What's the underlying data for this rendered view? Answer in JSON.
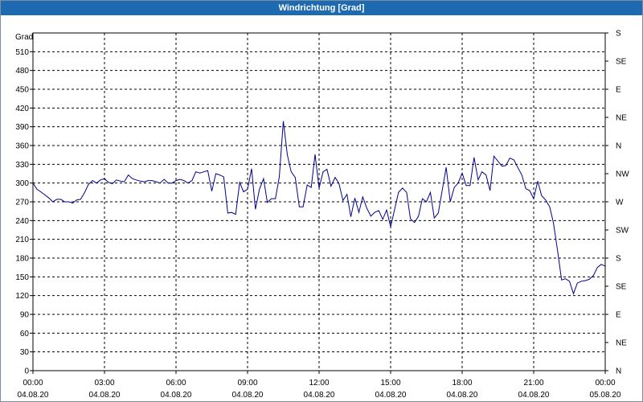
{
  "window": {
    "title": "Windrichtung [Grad]"
  },
  "colors": {
    "titlebar": "#1e6ab0",
    "series": "#00008b",
    "grid": "#000000",
    "background": "#ffffff"
  },
  "chart_data": {
    "type": "line",
    "title": "Windrichtung [Grad]",
    "ylabel": "Grad",
    "xlabel": "",
    "ylim": [
      0,
      540
    ],
    "y_ticks": [
      0,
      30,
      60,
      90,
      120,
      150,
      180,
      210,
      240,
      270,
      300,
      330,
      360,
      390,
      420,
      450,
      480,
      510
    ],
    "y_right_ticks": [
      {
        "value": 0,
        "label": "N"
      },
      {
        "value": 45,
        "label": "NE"
      },
      {
        "value": 90,
        "label": "E"
      },
      {
        "value": 135,
        "label": "SE"
      },
      {
        "value": 180,
        "label": "S"
      },
      {
        "value": 225,
        "label": "SW"
      },
      {
        "value": 270,
        "label": "W"
      },
      {
        "value": 315,
        "label": "NW"
      },
      {
        "value": 360,
        "label": "N"
      },
      {
        "value": 405,
        "label": "NE"
      },
      {
        "value": 450,
        "label": "E"
      },
      {
        "value": 495,
        "label": "SE"
      },
      {
        "value": 540,
        "label": "S"
      }
    ],
    "x_ticks": [
      {
        "time": "00:00",
        "date": "04.08.20",
        "hour": 0
      },
      {
        "time": "03:00",
        "date": "04.08.20",
        "hour": 3
      },
      {
        "time": "06:00",
        "date": "04.08.20",
        "hour": 6
      },
      {
        "time": "09:00",
        "date": "04.08.20",
        "hour": 9
      },
      {
        "time": "12:00",
        "date": "04.08.20",
        "hour": 12
      },
      {
        "time": "15:00",
        "date": "04.08.20",
        "hour": 15
      },
      {
        "time": "18:00",
        "date": "04.08.20",
        "hour": 18
      },
      {
        "time": "21:00",
        "date": "04.08.20",
        "hour": 21
      },
      {
        "time": "00:00",
        "date": "05.08.20",
        "hour": 24
      }
    ],
    "xlim_hours": [
      0,
      24
    ],
    "grid": true,
    "series": [
      {
        "points": [
          [
            0.0,
            300
          ],
          [
            0.17,
            290
          ],
          [
            0.33,
            286
          ],
          [
            0.5,
            281
          ],
          [
            0.67,
            276
          ],
          [
            0.83,
            270
          ],
          [
            1.0,
            274
          ],
          [
            1.17,
            274
          ],
          [
            1.33,
            270
          ],
          [
            1.5,
            270
          ],
          [
            1.67,
            268
          ],
          [
            1.83,
            273
          ],
          [
            2.0,
            274
          ],
          [
            2.17,
            285
          ],
          [
            2.33,
            298
          ],
          [
            2.5,
            304
          ],
          [
            2.67,
            300
          ],
          [
            2.83,
            305
          ],
          [
            3.0,
            307
          ],
          [
            3.17,
            301
          ],
          [
            3.33,
            299
          ],
          [
            3.5,
            305
          ],
          [
            3.67,
            303
          ],
          [
            3.83,
            302
          ],
          [
            4.0,
            313
          ],
          [
            4.17,
            307
          ],
          [
            4.33,
            305
          ],
          [
            4.5,
            303
          ],
          [
            4.67,
            302
          ],
          [
            4.83,
            304
          ],
          [
            5.0,
            304
          ],
          [
            5.17,
            302
          ],
          [
            5.33,
            300
          ],
          [
            5.5,
            306
          ],
          [
            5.67,
            300
          ],
          [
            5.83,
            300
          ],
          [
            6.0,
            304
          ],
          [
            6.17,
            306
          ],
          [
            6.33,
            304
          ],
          [
            6.5,
            300
          ],
          [
            6.67,
            304
          ],
          [
            6.83,
            318
          ],
          [
            7.0,
            316
          ],
          [
            7.17,
            318
          ],
          [
            7.33,
            320
          ],
          [
            7.5,
            287
          ],
          [
            7.67,
            315
          ],
          [
            7.83,
            313
          ],
          [
            8.0,
            310
          ],
          [
            8.17,
            252
          ],
          [
            8.33,
            253
          ],
          [
            8.5,
            250
          ],
          [
            8.67,
            301
          ],
          [
            8.83,
            286
          ],
          [
            9.0,
            290
          ],
          [
            9.17,
            323
          ],
          [
            9.33,
            258
          ],
          [
            9.5,
            290
          ],
          [
            9.67,
            307
          ],
          [
            9.83,
            269
          ],
          [
            10.0,
            275
          ],
          [
            10.17,
            275
          ],
          [
            10.33,
            310
          ],
          [
            10.5,
            399
          ],
          [
            10.67,
            345
          ],
          [
            10.83,
            318
          ],
          [
            11.0,
            309
          ],
          [
            11.17,
            262
          ],
          [
            11.33,
            262
          ],
          [
            11.5,
            297
          ],
          [
            11.67,
            293
          ],
          [
            11.83,
            346
          ],
          [
            12.0,
            292
          ],
          [
            12.17,
            318
          ],
          [
            12.33,
            322
          ],
          [
            12.5,
            295
          ],
          [
            12.67,
            309
          ],
          [
            12.83,
            300
          ],
          [
            13.0,
            272
          ],
          [
            13.17,
            282
          ],
          [
            13.33,
            246
          ],
          [
            13.5,
            276
          ],
          [
            13.67,
            253
          ],
          [
            13.83,
            278
          ],
          [
            14.0,
            260
          ],
          [
            14.17,
            247
          ],
          [
            14.33,
            253
          ],
          [
            14.5,
            256
          ],
          [
            14.67,
            242
          ],
          [
            14.83,
            257
          ],
          [
            15.0,
            230
          ],
          [
            15.17,
            258
          ],
          [
            15.33,
            285
          ],
          [
            15.5,
            292
          ],
          [
            15.67,
            285
          ],
          [
            15.83,
            243
          ],
          [
            16.0,
            237
          ],
          [
            16.17,
            247
          ],
          [
            16.33,
            275
          ],
          [
            16.5,
            270
          ],
          [
            16.67,
            285
          ],
          [
            16.83,
            244
          ],
          [
            17.0,
            252
          ],
          [
            17.17,
            290
          ],
          [
            17.33,
            325
          ],
          [
            17.5,
            270
          ],
          [
            17.67,
            293
          ],
          [
            17.83,
            300
          ],
          [
            18.0,
            316
          ],
          [
            18.17,
            296
          ],
          [
            18.33,
            296
          ],
          [
            18.5,
            341
          ],
          [
            18.67,
            305
          ],
          [
            18.83,
            318
          ],
          [
            19.0,
            313
          ],
          [
            19.17,
            288
          ],
          [
            19.33,
            343
          ],
          [
            19.5,
            335
          ],
          [
            19.67,
            327
          ],
          [
            19.83,
            328
          ],
          [
            20.0,
            340
          ],
          [
            20.17,
            337
          ],
          [
            20.33,
            325
          ],
          [
            20.5,
            313
          ],
          [
            20.67,
            291
          ],
          [
            20.83,
            288
          ],
          [
            21.0,
            275
          ],
          [
            21.17,
            303
          ],
          [
            21.33,
            280
          ],
          [
            21.5,
            273
          ],
          [
            21.67,
            262
          ],
          [
            21.83,
            236
          ],
          [
            22.0,
            192
          ],
          [
            22.17,
            145
          ],
          [
            22.33,
            147
          ],
          [
            22.5,
            143
          ],
          [
            22.67,
            123
          ],
          [
            22.83,
            140
          ],
          [
            23.0,
            143
          ],
          [
            23.17,
            144
          ],
          [
            23.33,
            146
          ],
          [
            23.5,
            152
          ],
          [
            23.67,
            165
          ],
          [
            23.83,
            170
          ],
          [
            24.0,
            167
          ]
        ]
      }
    ]
  }
}
